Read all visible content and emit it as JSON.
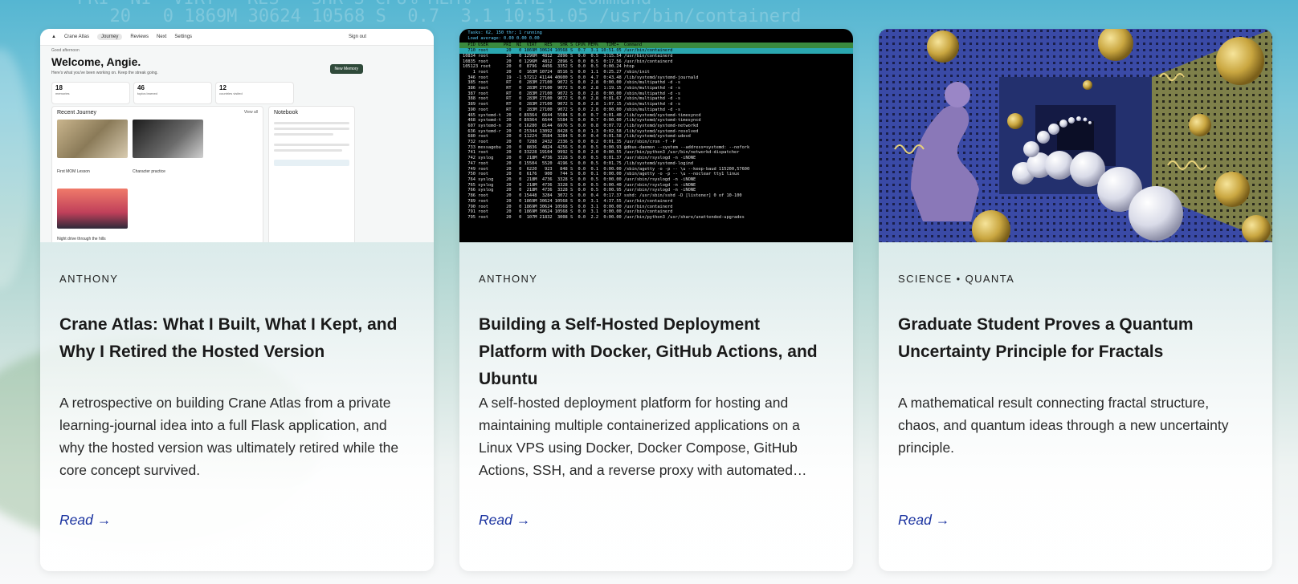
{
  "background": {
    "terminal_top_line": "  20   0 1869M 30624 10568 S  0.7  3.1 10:51.05 /usr/bin/containerd",
    "terminal_header_line": "PRI  NI  VIRT   RES   SHR S CPU% MEM%   TIME+  Command"
  },
  "cards": [
    {
      "meta": "ANTHONY",
      "title": "Crane Atlas: What I Built, What I Kept, and Why I Retired the Hosted Version",
      "description": "A retrospective on building Crane Atlas from a private learning-journal idea into a full Flask application, and why the hosted version was ultimately retired while the core concept survived.",
      "read_label": "Read →",
      "thumb": {
        "app_name": "Crane Atlas",
        "nav": [
          "Journey",
          "Reviews",
          "Next",
          "Settings"
        ],
        "signout": "Sign out",
        "greeting_sub": "Good afternoon",
        "welcome": "Welcome, Angie.",
        "welcome_sub": "Here's what you've been working on. Keep the streak going.",
        "new_entry": "New Memory",
        "stats": [
          {
            "value": "18",
            "label": "memories"
          },
          {
            "value": "46",
            "label": "topics learned"
          },
          {
            "value": "12",
            "label": "countries visited"
          }
        ],
        "recent_title": "Recent Journey",
        "view_all": "View all",
        "notebook_title": "Notebook",
        "captions": [
          "First MOM Lesson",
          "Character practice",
          "Night drive through the hills"
        ]
      }
    },
    {
      "meta": "ANTHONY",
      "title": "Building a Self-Hosted Deployment Platform with Docker, GitHub Actions, and Ubuntu",
      "description": "A self-hosted deployment platform for hosting and maintaining multiple containerized applications on a Linux VPS using Docker, Docker Compose, GitHub Actions, SSH, and a reverse proxy with automated…",
      "read_label": "Read →",
      "thumb": {
        "header": "  Tasks: 62, 150 thr; 1 running\n  Load average: 0.00 0.00 0.00",
        "columns": "  PID USER      PRI  NI  VIRT   RES   SHR S CPU% MEM%   TIME+  Command",
        "selected": "  710 root       20   0 1869M 30624 10568 S  0.7  3.1 10:51.05 /usr/bin/containerd",
        "rows": [
          "10834 root       20   0 1296M  4812  2896 S  0.0  0.5  3:15.54 /usr/bin/containerd",
          "10835 root       20   0 1296M  4812  2896 S  0.0  0.5  0:17.56 /usr/bin/containerd",
          "105123 root      20   0  8796  4456  3352 S  0.0  0.5  0:00.24 htop",
          "    1 root       20   0  163M 10724  8516 S  0.0  1.1  0:25.27 /sbin/init",
          "  346 root       19  -1 57212 41144 40600 S  0.0  4.7  0:43.48 /lib/systemd/systemd-journald",
          "  385 root       RT   0  283M 27100  9072 S  0.0  2.8  0:00.00 /sbin/multipathd -d -s",
          "  386 root       RT   0  283M 27100  9072 S  0.0  2.8  1:19.15 /sbin/multipathd -d -s",
          "  387 root       RT   0  283M 27100  9072 S  0.0  2.8  0:00.00 /sbin/multipathd -d -s",
          "  388 root       RT   0  283M 27100  9072 S  0.0  2.8  0:01.67 /sbin/multipathd -d -s",
          "  389 root       RT   0  283M 27100  9072 S  0.0  2.8  1:07.15 /sbin/multipathd -d -s",
          "  390 root       RT   0  283M 27100  9072 S  0.0  2.8  0:00.00 /sbin/multipathd -d -s",
          "  465 systemd-t  20   0 89364  6644  5584 S  0.0  0.7  0:01.40 /lib/systemd/systemd-timesyncd",
          "  468 systemd-t  20   0 89364  6644  5584 S  0.0  0.7  0:00.00 /lib/systemd/systemd-timesyncd",
          "  607 systemd-n  20   0 16280  8144  6976 S  0.0  0.8  0:07.72 /lib/systemd/systemd-networkd",
          "  636 systemd-r  20   0 25344 13092  8428 S  0.0  1.3  0:02.58 /lib/systemd/systemd-resolved",
          "  680 root       20   0 11224  3584  3284 S  0.0  0.4  0:01.58 /lib/systemd/systemd-udevd",
          "  732 root       20   0  7288  2432  2336 S  0.0  0.2  0:01.35 /usr/sbin/cron -f -P",
          "  733 messagebu  20   0  8836  4824  4256 S  0.0  0.5  0:00.93 @dbus-daemon --system --address=systemd: --nofork",
          "  741 root       20   0 33228 19104  9992 S  0.0  2.0  0:00.55 /usr/bin/python3 /usr/bin/networkd-dispatcher",
          "  742 syslog     20   0  218M  4736  3328 S  0.0  0.5  0:01.37 /usr/sbin/rsyslogd -n -iNONE",
          "  747 root       20   0 15504  5520  4196 S  0.0  0.5  0:01.75 /lib/systemd/systemd-logind",
          "  749 root       20   0  6220   923   848 S  0.0  0.1  0:00.00 /sbin/agetty -o -p -- \\u --keep-baud 115200,57600",
          "  750 root       20   0  6176   900   744 S  0.0  0.1  0:00.00 /sbin/agetty -o -p -- \\u --noclear tty1 linux",
          "  764 syslog     20   0  218M  4736  3328 S  0.0  0.5  0:00.00 /usr/sbin/rsyslogd -n -iNONE",
          "  765 syslog     20   0  218M  4736  3328 S  0.0  0.5  0:00.40 /usr/sbin/rsyslogd -n -iNONE",
          "  766 syslog     20   0  218M  4736  3328 S  0.0  0.5  0:00.95 /usr/sbin/rsyslogd -n -iNONE",
          "  786 root       20   0 15448  3284  3072 S  0.0  0.4  0:17.37 sshd: /usr/sbin/sshd -D [listener] 0 of 10-100",
          "  789 root       20   0 1869M 30624 10568 S  0.0  3.1  4:37.55 /usr/bin/containerd",
          "  790 root       20   0 1869M 30624 10568 S  0.0  3.1  0:00.00 /usr/bin/containerd",
          "  791 root       20   0 1869M 30624 10568 S  0.0  3.1  0:00.00 /usr/bin/containerd",
          "  795 root       20   0  107M 21832  3008 S  0.0  2.2  0:00.00 /usr/bin/python3 /usr/share/unattended-upgrades"
        ]
      }
    },
    {
      "meta": "SCIENCE • QUANTA",
      "title": "Graduate Student Proves a Quantum Uncertainty Principle for Fractals",
      "description": "A mathematical result connecting fractal structure, chaos, and quantum ideas through a new uncertainty principle.",
      "read_label": "Read →",
      "thumb": {}
    }
  ]
}
